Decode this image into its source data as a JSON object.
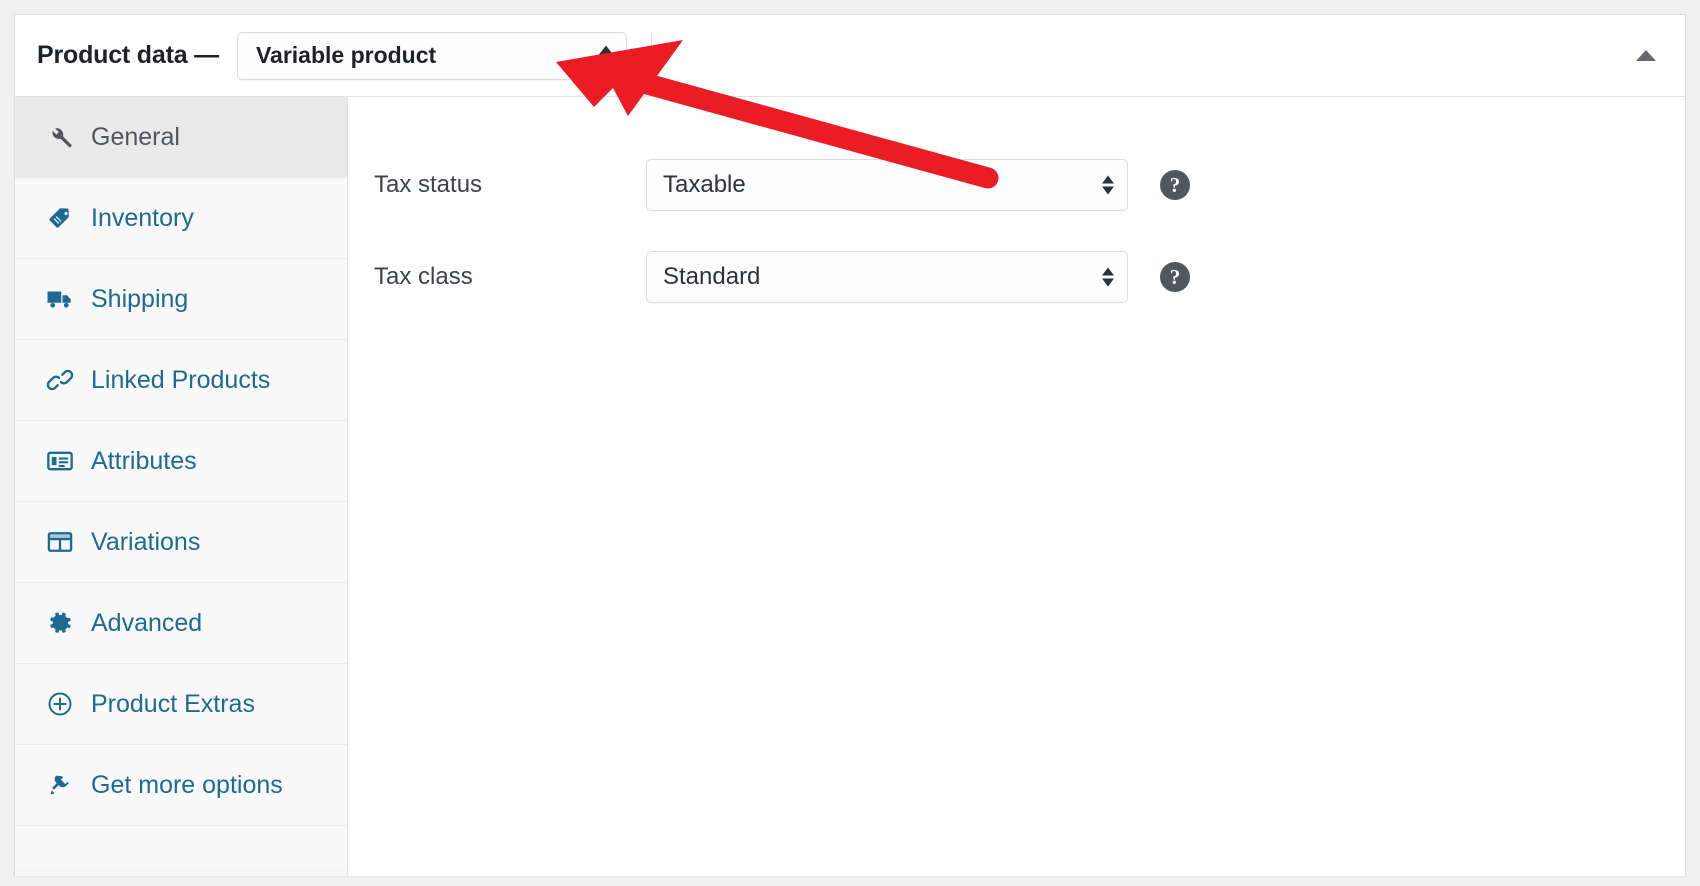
{
  "header": {
    "title": "Product data —",
    "product_type": {
      "selected": "Variable product",
      "icon": "stepper-arrows-icon"
    },
    "collapse_icon": "caret-up-icon"
  },
  "sidebar": {
    "items": [
      {
        "label": "General",
        "icon": "wrench-icon",
        "active": true
      },
      {
        "label": "Inventory",
        "icon": "tag-icon",
        "active": false
      },
      {
        "label": "Shipping",
        "icon": "truck-icon",
        "active": false
      },
      {
        "label": "Linked Products",
        "icon": "link-icon",
        "active": false
      },
      {
        "label": "Attributes",
        "icon": "list-card-icon",
        "active": false
      },
      {
        "label": "Variations",
        "icon": "grid-icon",
        "active": false
      },
      {
        "label": "Advanced",
        "icon": "gear-icon",
        "active": false
      },
      {
        "label": "Product Extras",
        "icon": "plus-circle-icon",
        "active": false
      },
      {
        "label": "Get more options",
        "icon": "plug-icon",
        "active": false
      }
    ]
  },
  "main": {
    "fields": [
      {
        "label": "Tax status",
        "value": "Taxable",
        "help": "?"
      },
      {
        "label": "Tax class",
        "value": "Standard",
        "help": "?"
      }
    ]
  },
  "annotation": {
    "type": "arrow",
    "color": "#ec1c24",
    "points_to": "product_type_select"
  },
  "colors": {
    "link": "#1d6a94",
    "page_bg": "#f0f0f1",
    "panel_bg": "#ffffff",
    "sidebar_bg": "#f9f9f9",
    "active_tab_bg": "#eaeaea",
    "border": "#dcdcde",
    "text": "#1d2327",
    "help_bg": "#50575e",
    "annotation": "#ec1c24"
  }
}
